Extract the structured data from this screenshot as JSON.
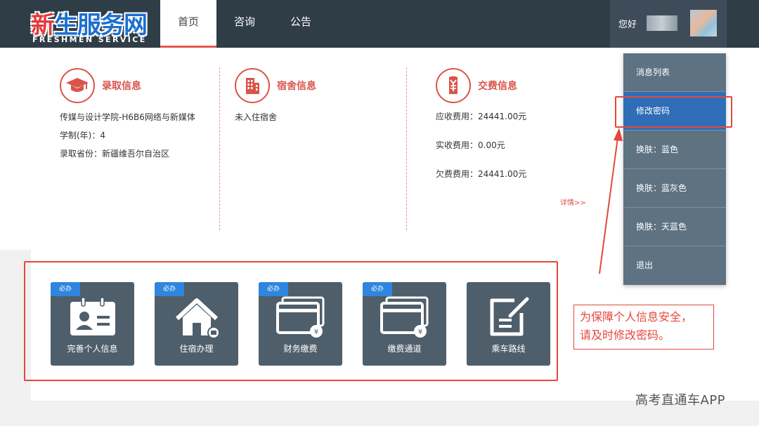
{
  "header": {
    "logo_text": "新生服务网",
    "logo_subtext": "FRESHMEN SERVICE",
    "nav": [
      {
        "label": "首页",
        "active": true
      },
      {
        "label": "咨询",
        "active": false
      },
      {
        "label": "公告",
        "active": false
      }
    ],
    "greeting": "您好"
  },
  "admission": {
    "title": "录取信息",
    "icon": "graduation-cap-icon",
    "lines": [
      "传媒与设计学院-H6B6网络与新媒体",
      "学制(年)：4",
      "录取省份：新疆维吾尔自治区"
    ]
  },
  "dorm": {
    "title": "宿舍信息",
    "icon": "building-icon",
    "lines": [
      "未入住宿舍"
    ]
  },
  "fee": {
    "title": "交费信息",
    "icon": "yuan-sign-icon",
    "lines": [
      "应收费用：24441.00元",
      "实收费用：0.00元",
      "欠费费用：24441.00元"
    ],
    "detail_link": "详情>>"
  },
  "dropdown": {
    "items": [
      {
        "label": "消息列表",
        "active": false
      },
      {
        "label": "修改密码",
        "active": true
      },
      {
        "label": "换肤：蓝色",
        "active": false
      },
      {
        "label": "换肤：蓝灰色",
        "active": false
      },
      {
        "label": "换肤：天蓝色",
        "active": false
      },
      {
        "label": "退出",
        "active": false
      }
    ]
  },
  "tiles": [
    {
      "label": "完善个人信息",
      "badge": "必办",
      "icon": "id-card-icon"
    },
    {
      "label": "住宿办理",
      "badge": "必办",
      "icon": "house-icon"
    },
    {
      "label": "财务缴费",
      "badge": "必办",
      "icon": "card-yuan-icon"
    },
    {
      "label": "缴费通道",
      "badge": "必办",
      "icon": "card-yuan-icon"
    },
    {
      "label": "乘车路线",
      "badge": "",
      "icon": "edit-document-icon"
    }
  ],
  "notice": {
    "line1": "为保障个人信息安全，",
    "line2": "请及时修改密码。"
  },
  "watermark": "高考直通车APP",
  "colors": {
    "topbar": "#2f3d47",
    "accent_red": "#d9544a",
    "dropdown_bg": "#5e7282",
    "dropdown_active": "#2f6eb7",
    "tile_bg": "#4f5e6b",
    "badge_blue": "#2e86de"
  }
}
